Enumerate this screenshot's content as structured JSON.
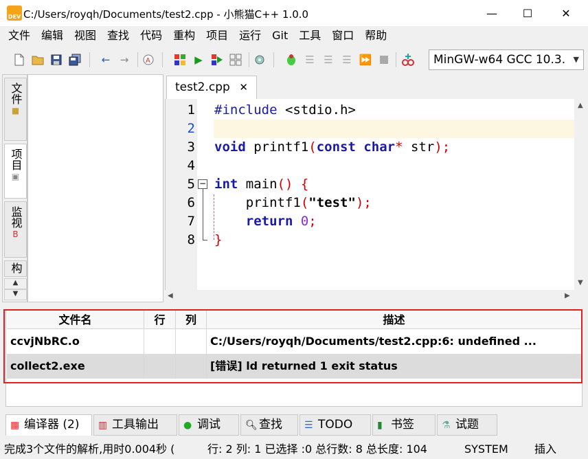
{
  "window": {
    "title": "C:/Users/royqh/Documents/test2.cpp - 小熊猫C++ 1.0.0",
    "icon_text": "DEV",
    "minimize_glyph": "—",
    "maximize_glyph": "☐",
    "close_glyph": "✕"
  },
  "menu": [
    "文件",
    "编辑",
    "视图",
    "查找",
    "代码",
    "重构",
    "项目",
    "运行",
    "Git",
    "工具",
    "窗口",
    "帮助"
  ],
  "toolbar": {
    "compiler": "MinGW-w64 GCC 10.3.",
    "icons": [
      "new-file-icon",
      "open-file-icon",
      "save-icon",
      "save-all-icon",
      "undo-icon",
      "redo-icon",
      "format-icon",
      "compile-icon",
      "run-icon",
      "compile-run-icon",
      "rebuild-icon",
      "syntax-check-icon",
      "debug-icon",
      "step-over-icon",
      "step-into-icon",
      "step-out-icon",
      "continue-icon",
      "stop-icon",
      "add-watch-icon"
    ]
  },
  "left_tabs": [
    "文件",
    "项目",
    "监视",
    "构"
  ],
  "editor": {
    "tab_label": "test2.cpp",
    "tab_close": "✕",
    "line_numbers": [
      "1",
      "2",
      "3",
      "4",
      "5",
      "6",
      "7",
      "8"
    ],
    "lines": {
      "l1_pre": "#include ",
      "l1_rest": "<stdio.h>",
      "l3_kw": "void",
      "l3_fn": " printf1",
      "l3_p1": "(",
      "l3_kw2": "const char",
      "l3_p2": "* ",
      "l3_arg": "str",
      "l3_p3": ");",
      "l5_kw": "int",
      "l5_fn": " main",
      "l5_p": "() {",
      "l6_fn": "    printf1",
      "l6_p1": "(",
      "l6_str": "\"test\"",
      "l6_p2": ");",
      "l7_kw": "    return ",
      "l7_num": "0",
      "l7_p": ";",
      "l8_p": "}"
    },
    "fold_glyph": "−"
  },
  "messages": {
    "headers": [
      "文件名",
      "行",
      "列",
      "描述"
    ],
    "rows": [
      {
        "file": "ccvjNbRC.o",
        "line": "",
        "col": "",
        "desc": "C:/Users/royqh/Documents/test2.cpp:6: undefined ..."
      },
      {
        "file": "collect2.exe",
        "line": "",
        "col": "",
        "desc": "[错误] ld returned 1 exit status"
      }
    ]
  },
  "bottom_tabs": [
    {
      "label": "编译器 (2)",
      "icon": "compiler-icon"
    },
    {
      "label": "工具输出",
      "icon": "tools-output-icon"
    },
    {
      "label": "调试",
      "icon": "debug-icon"
    },
    {
      "label": "查找",
      "icon": "search-icon"
    },
    {
      "label": "TODO",
      "icon": "todo-icon"
    },
    {
      "label": "书签",
      "icon": "bookmark-icon"
    },
    {
      "label": "试题",
      "icon": "problem-icon"
    }
  ],
  "status": {
    "parse": "完成3个文件的解析,用时0.004秒 (",
    "position": "行: 2 列: 1 已选择 :0 总行数: 8 总长度: 104",
    "encoding": "SYSTEM",
    "mode": "插入"
  }
}
